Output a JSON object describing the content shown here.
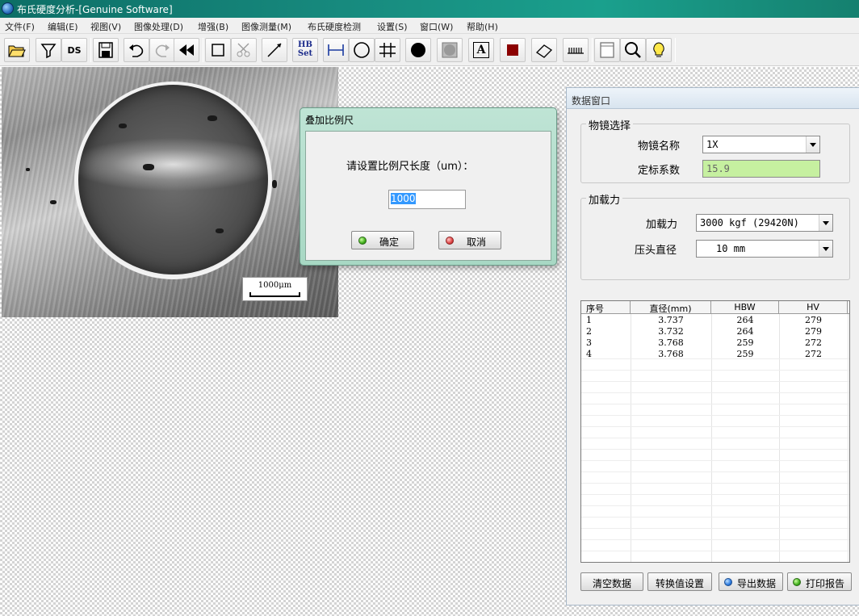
{
  "window": {
    "title": "布氏硬度分析-[Genuine Software]"
  },
  "menu": [
    "文件(F)",
    "编辑(E)",
    "视图(V)",
    "图像处理(D)",
    "增强(B)",
    "图像测量(M)",
    "布氏硬度检测",
    "设置(S)",
    "窗口(W)",
    "帮助(H)"
  ],
  "toolbar": {
    "buttons": [
      "open-folder-icon",
      "funnel-icon",
      "ds",
      "save-icon",
      "undo-icon",
      "redo-icon",
      "rewind-icon",
      "rectangle-icon",
      "scissors-icon",
      "diagonal-line-icon",
      "hb-set",
      "horizontal-measure-icon",
      "circle-icon",
      "grid-icon",
      "filled-circle-icon",
      "gray-square-icon",
      "text-a-icon",
      "red-square-icon",
      "eraser-icon",
      "ruler-icon",
      "page-icon",
      "magnifier-icon",
      "lightbulb-icon"
    ],
    "ds_label": "DS",
    "hb_label_1": "HB",
    "hb_label_2": "Set",
    "text_tool_label": "A"
  },
  "image": {
    "scale_label": "1000μm"
  },
  "dialog": {
    "title": "叠加比例尺",
    "prompt": "请设置比例尺长度（um）：",
    "value": "1000",
    "ok_label": "确定",
    "cancel_label": "取消"
  },
  "data_window": {
    "title": "数据窗口",
    "objective_group": "物镜选择",
    "objective_label": "物镜名称",
    "objective_value": "1X",
    "calibration_label": "定标系数",
    "calibration_value": "15.9",
    "load_group": "加载力",
    "load_label": "加载力",
    "load_value": "3000 kgf (29420N)",
    "indenter_label": "压头直径",
    "indenter_value": "10 mm",
    "table": {
      "headers": [
        "序号",
        "直径(mm)",
        "HBW",
        "HV"
      ],
      "rows": [
        [
          "1",
          "3.737",
          "264",
          "279"
        ],
        [
          "2",
          "3.732",
          "264",
          "279"
        ],
        [
          "3",
          "3.768",
          "259",
          "272"
        ],
        [
          "4",
          "3.768",
          "259",
          "272"
        ]
      ]
    },
    "buttons": {
      "clear": "清空数据",
      "convert": "转换值设置",
      "export": "导出数据",
      "print": "打印报告"
    }
  },
  "colors": {
    "titlebar": "#178a7e",
    "dialog_frame": "#a8d8c4",
    "calibration_bg": "#c6f0a0",
    "selection": "#3399ff"
  }
}
